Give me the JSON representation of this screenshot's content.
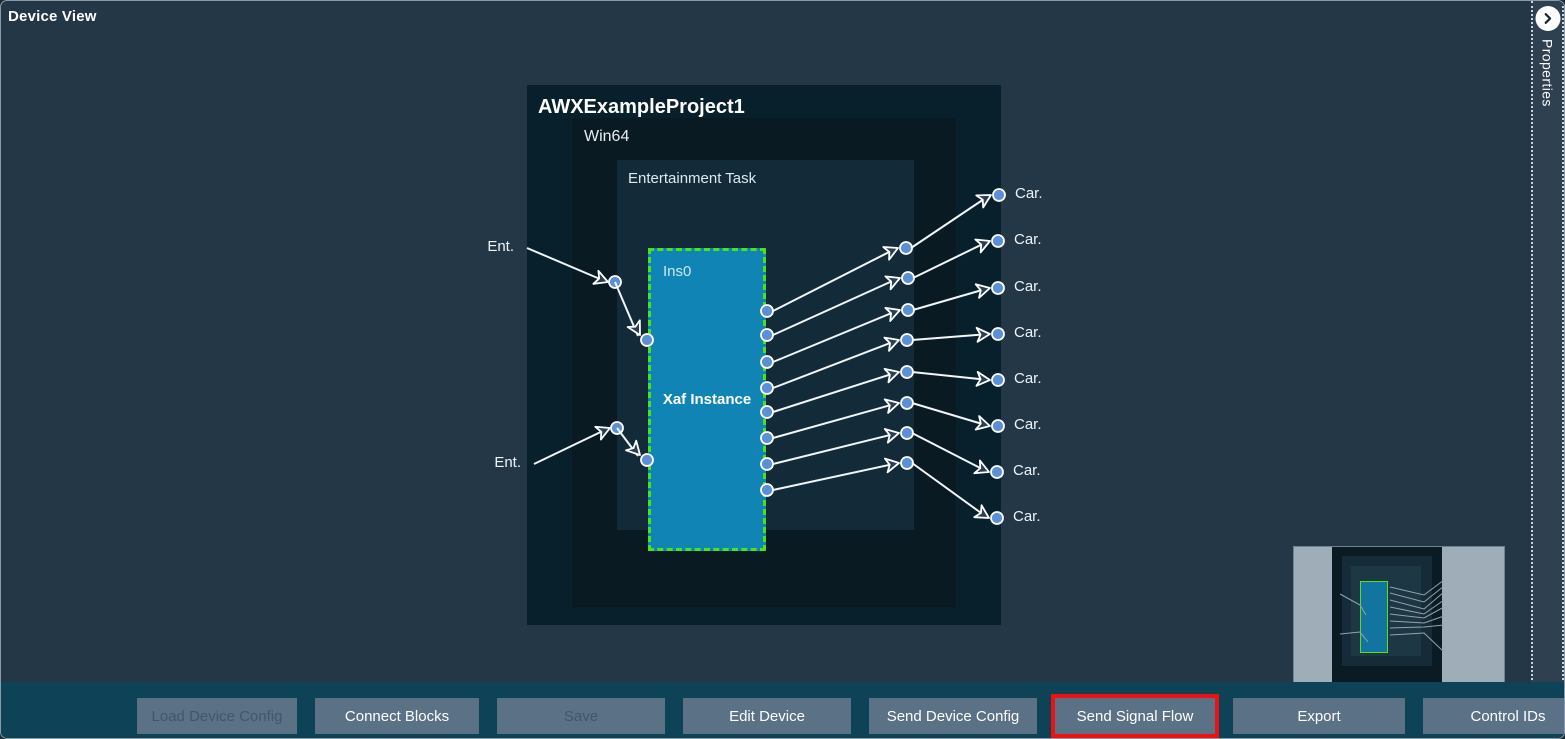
{
  "window": {
    "title": "Device View"
  },
  "rail": {
    "label": "Properties",
    "toggle_icon": "chevron-right-icon"
  },
  "diagram": {
    "project_label": "AWXExampleProject1",
    "platform_label": "Win64",
    "task_label": "Entertainment Task",
    "block": {
      "instance_label": "Ins0",
      "name": "Xaf Instance",
      "fill_color": "#1084b5",
      "selection_color": "#4ee018",
      "input_port_count": 2,
      "output_port_count": 8
    },
    "inputs": [
      {
        "label": "Ent."
      },
      {
        "label": "Ent."
      }
    ],
    "outputs": [
      {
        "label": "Car."
      },
      {
        "label": "Car."
      },
      {
        "label": "Car."
      },
      {
        "label": "Car."
      },
      {
        "label": "Car."
      },
      {
        "label": "Car."
      },
      {
        "label": "Car."
      },
      {
        "label": "Car."
      }
    ]
  },
  "toolbar": {
    "buttons": [
      {
        "label": "Load Device Config",
        "state": "disabled",
        "highlighted": false
      },
      {
        "label": "Connect Blocks",
        "state": "enabled",
        "highlighted": false
      },
      {
        "label": "Save",
        "state": "disabled",
        "highlighted": false
      },
      {
        "label": "Edit Device",
        "state": "enabled",
        "highlighted": false
      },
      {
        "label": "Send Device Config",
        "state": "enabled",
        "highlighted": false
      },
      {
        "label": "Send Signal Flow",
        "state": "enabled",
        "highlighted": true
      },
      {
        "label": "Export",
        "state": "enabled",
        "highlighted": false
      },
      {
        "label": "Control IDs",
        "state": "enabled",
        "highlighted": false
      }
    ],
    "highlight_color": "#ee1111"
  },
  "minimap": {
    "present": true
  }
}
